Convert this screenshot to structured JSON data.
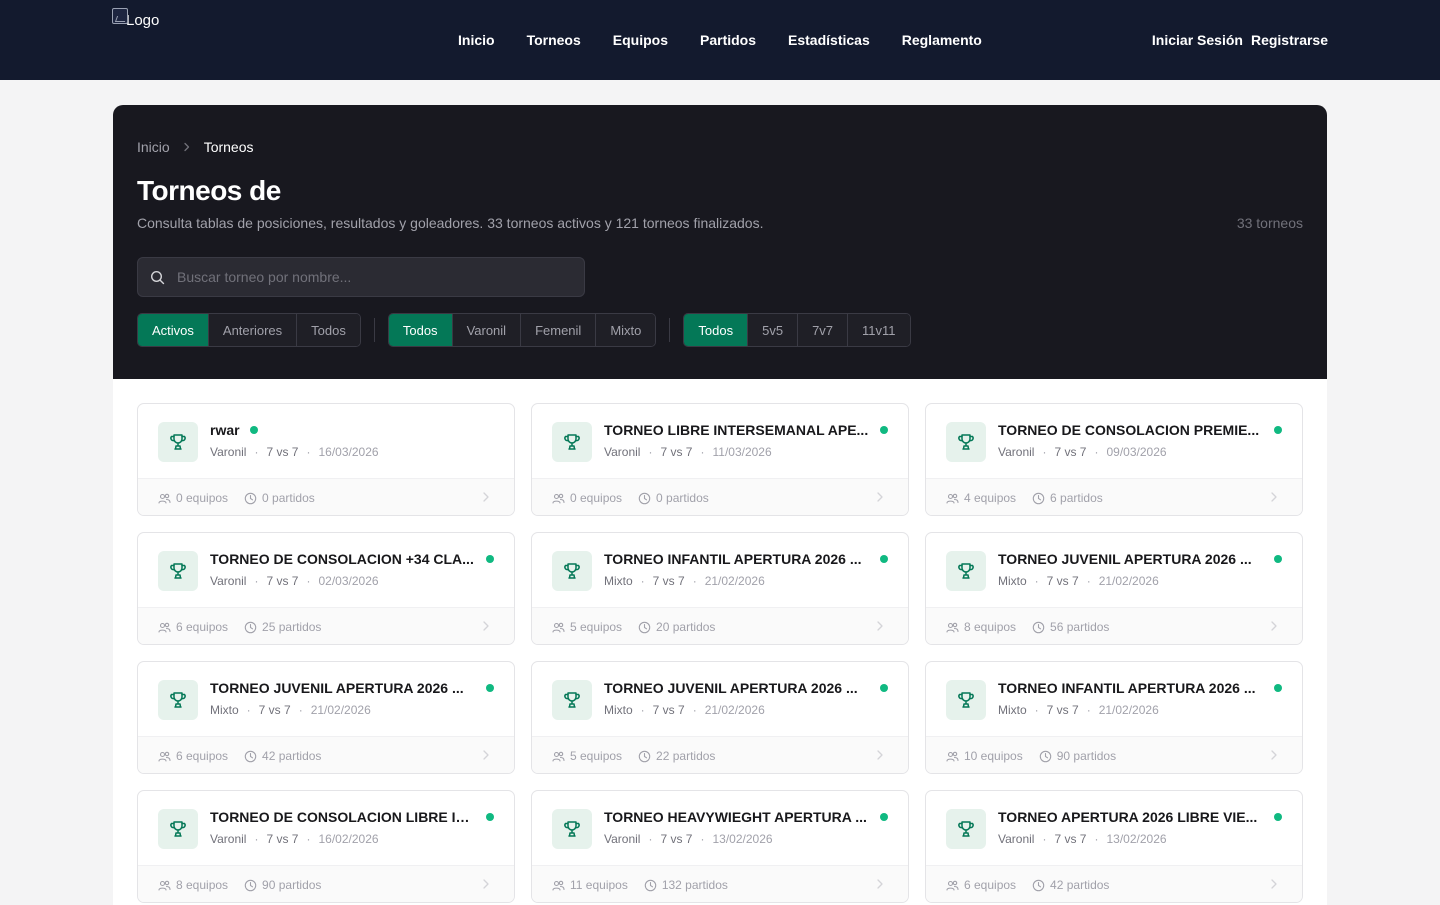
{
  "nav": {
    "logo_alt": "Logo",
    "links": [
      "Inicio",
      "Torneos",
      "Equipos",
      "Partidos",
      "Estadísticas",
      "Reglamento"
    ],
    "login": "Iniciar Sesión",
    "register": "Registrarse"
  },
  "breadcrumb": {
    "home": "Inicio",
    "current": "Torneos"
  },
  "header": {
    "title": "Torneos de",
    "subtitle": "Consulta tablas de posiciones, resultados y goleadores. 33 torneos activos y 121 torneos finalizados.",
    "count": "33 torneos"
  },
  "search": {
    "placeholder": "Buscar torneo por nombre...",
    "value": ""
  },
  "filters": {
    "status": [
      "Activos",
      "Anteriores",
      "Todos"
    ],
    "gender": [
      "Todos",
      "Varonil",
      "Femenil",
      "Mixto"
    ],
    "format": [
      "Todos",
      "5v5",
      "7v7",
      "11v11"
    ],
    "active": {
      "status": "Activos",
      "gender": "Todos",
      "format": "Todos"
    }
  },
  "colors": {
    "accent": "#047857",
    "active_dot": "#10b981",
    "navbar": "#131a2e",
    "hero": "#18181f"
  },
  "tournaments": [
    {
      "name": "rwar",
      "gender": "Varonil",
      "format": "7 vs 7",
      "date": "16/03/2026",
      "teams": "0 equipos",
      "matches": "0 partidos"
    },
    {
      "name": "TORNEO LIBRE INTERSEMANAL APE...",
      "gender": "Varonil",
      "format": "7 vs 7",
      "date": "11/03/2026",
      "teams": "0 equipos",
      "matches": "0 partidos"
    },
    {
      "name": "TORNEO DE CONSOLACION PREMIE...",
      "gender": "Varonil",
      "format": "7 vs 7",
      "date": "09/03/2026",
      "teams": "4 equipos",
      "matches": "6 partidos"
    },
    {
      "name": "TORNEO DE CONSOLACION +34 CLA...",
      "gender": "Varonil",
      "format": "7 vs 7",
      "date": "02/03/2026",
      "teams": "6 equipos",
      "matches": "25 partidos"
    },
    {
      "name": "TORNEO INFANTIL APERTURA 2026 ...",
      "gender": "Mixto",
      "format": "7 vs 7",
      "date": "21/02/2026",
      "teams": "5 equipos",
      "matches": "20 partidos"
    },
    {
      "name": "TORNEO JUVENIL APERTURA 2026 ...",
      "gender": "Mixto",
      "format": "7 vs 7",
      "date": "21/02/2026",
      "teams": "8 equipos",
      "matches": "56 partidos"
    },
    {
      "name": "TORNEO JUVENIL APERTURA 2026 ...",
      "gender": "Mixto",
      "format": "7 vs 7",
      "date": "21/02/2026",
      "teams": "6 equipos",
      "matches": "42 partidos"
    },
    {
      "name": "TORNEO JUVENIL APERTURA 2026 ...",
      "gender": "Mixto",
      "format": "7 vs 7",
      "date": "21/02/2026",
      "teams": "5 equipos",
      "matches": "22 partidos"
    },
    {
      "name": "TORNEO INFANTIL APERTURA 2026 ...",
      "gender": "Mixto",
      "format": "7 vs 7",
      "date": "21/02/2026",
      "teams": "10 equipos",
      "matches": "90 partidos"
    },
    {
      "name": "TORNEO DE CONSOLACION LIBRE IN...",
      "gender": "Varonil",
      "format": "7 vs 7",
      "date": "16/02/2026",
      "teams": "8 equipos",
      "matches": "90 partidos"
    },
    {
      "name": "TORNEO HEAVYWIEGHT APERTURA ...",
      "gender": "Varonil",
      "format": "7 vs 7",
      "date": "13/02/2026",
      "teams": "11 equipos",
      "matches": "132 partidos"
    },
    {
      "name": "TORNEO APERTURA 2026 LIBRE VIE...",
      "gender": "Varonil",
      "format": "7 vs 7",
      "date": "13/02/2026",
      "teams": "6 equipos",
      "matches": "42 partidos"
    }
  ]
}
